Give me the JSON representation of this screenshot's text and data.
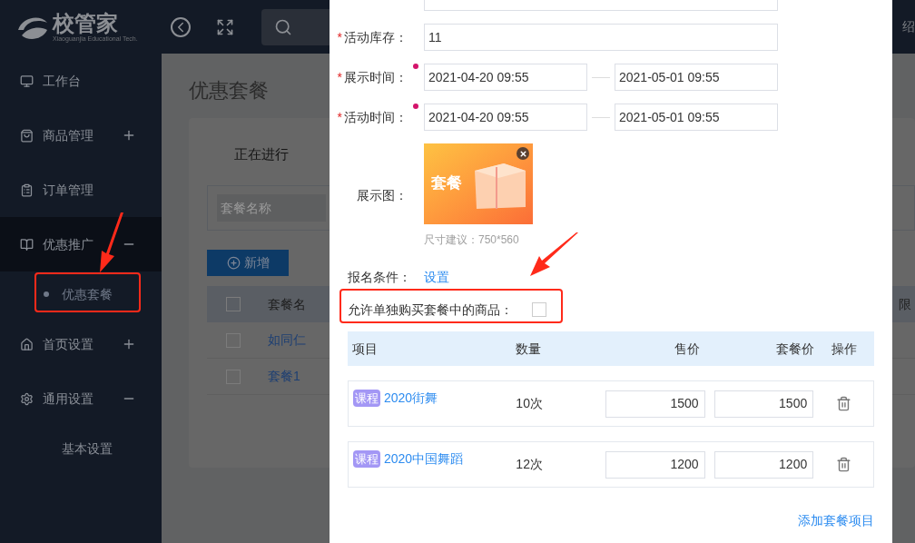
{
  "sidebar": {
    "logo": {
      "name": "校管家",
      "tagline": "Xiaoguanjia Educational Tech."
    },
    "items": [
      {
        "label": "工作台",
        "kind": "link",
        "selected": false
      },
      {
        "label": "商品管理",
        "kind": "group",
        "expanded": false,
        "selected": false
      },
      {
        "label": "订单管理",
        "kind": "link",
        "selected": false
      },
      {
        "label": "优惠推广",
        "kind": "group",
        "expanded": true,
        "selected": true,
        "children": [
          {
            "label": "优惠套餐",
            "selected": true
          }
        ]
      },
      {
        "label": "首页设置",
        "kind": "group",
        "expanded": false,
        "selected": false
      },
      {
        "label": "通用设置",
        "kind": "group",
        "expanded": true,
        "selected": false,
        "children": [
          {
            "label": "基本设置",
            "selected": false
          }
        ]
      }
    ]
  },
  "topbar": {
    "right_text": "绍"
  },
  "page": {
    "title": "优惠套餐",
    "tab": "正在进行",
    "search_placeholder": "套餐名称",
    "new_button": "新增",
    "table": {
      "columns": [
        "套餐名",
        "限"
      ],
      "all_checked": false,
      "rows": [
        {
          "name": "如同仁",
          "checked": false
        },
        {
          "name": "套餐1",
          "checked": false
        }
      ]
    }
  },
  "modal": {
    "fields": [
      {
        "kind": "text",
        "label": "活动库存：",
        "required_mark": "*",
        "value": "11"
      },
      {
        "kind": "daterange",
        "label": "展示时间：",
        "required_mark": "*",
        "marked": true,
        "start": "2021-04-20 09:55",
        "end": "2021-05-01 09:55"
      },
      {
        "kind": "daterange",
        "label": "活动时间：",
        "required_mark": "*",
        "marked": true,
        "start": "2021-04-20 09:55",
        "end": "2021-05-01 09:55"
      },
      {
        "kind": "image",
        "label": "展示图：",
        "image_text": "套餐",
        "hint": "尺寸建议：750*560"
      }
    ],
    "signup": {
      "label": "报名条件：",
      "link": "设置"
    },
    "allow_single": {
      "label": "允许单独购买套餐中的商品：",
      "checked": false
    },
    "items_table": {
      "columns": [
        "项目",
        "数量",
        "售价",
        "套餐价",
        "操作"
      ],
      "rows": [
        {
          "tag": "课程",
          "name": "2020街舞",
          "quantity": "10次",
          "price": "1500",
          "package_price": "1500"
        },
        {
          "tag": "课程",
          "name": "2020中国舞蹈",
          "quantity": "12次",
          "price": "1200",
          "package_price": "1200"
        }
      ]
    },
    "add_link": "添加套餐项目"
  }
}
